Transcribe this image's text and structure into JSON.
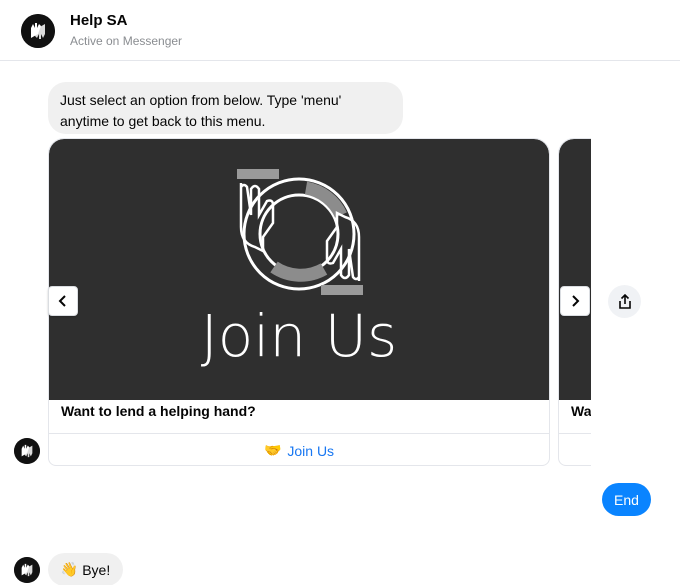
{
  "header": {
    "title": "Help SA",
    "status": "Active on Messenger"
  },
  "messages": {
    "intro": "Just select an option from below. Type 'menu' anytime to get back to this menu.",
    "end": "End",
    "bye_emoji": "👋",
    "bye_text": "Bye!"
  },
  "carousel": {
    "cards": [
      {
        "hero_text": "Join Us",
        "title": "Want to lend a helping hand?",
        "button_emoji": "🤝",
        "button_label": "Join Us"
      },
      {
        "title": "Wa"
      }
    ]
  },
  "colors": {
    "accent": "#1877f2",
    "user_bubble": "#0a84ff",
    "bot_bubble": "#f0f0f0",
    "card_image_bg": "#2f2f2f"
  },
  "icons": {
    "logo": "helping-hand-logo-icon",
    "prev": "chevron-left-icon",
    "next": "chevron-right-icon",
    "share": "share-icon"
  }
}
